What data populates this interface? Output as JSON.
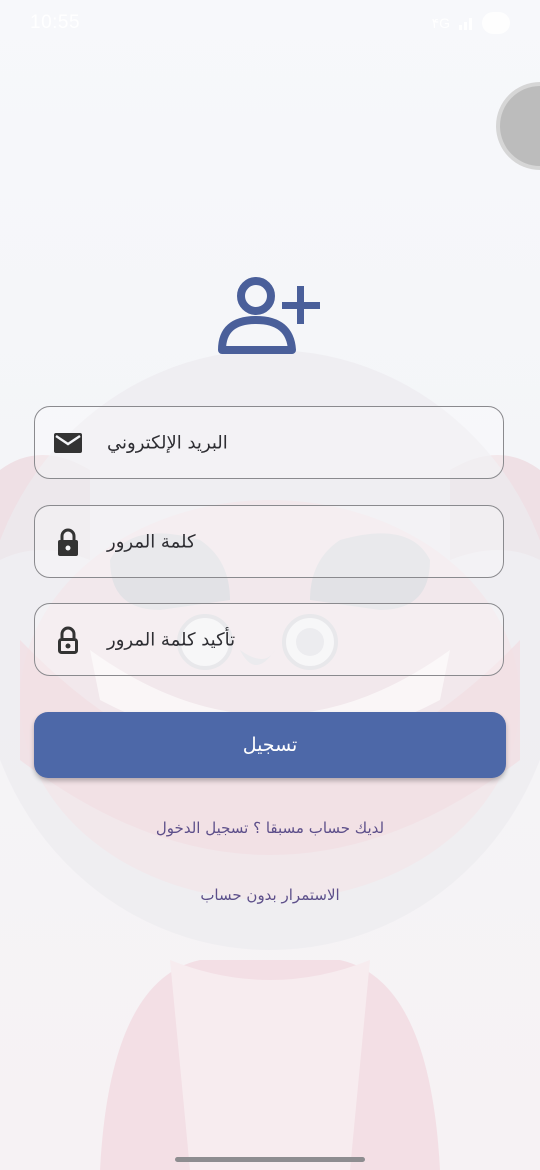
{
  "status_bar": {
    "time": "10:55",
    "signal_text": "۴G"
  },
  "header": {
    "icon": "person-add-icon"
  },
  "form": {
    "email": {
      "icon": "mail-icon",
      "placeholder": "البريد الإلكتروني"
    },
    "password": {
      "icon": "lock-icon",
      "placeholder": "كلمة المرور"
    },
    "confirm_password": {
      "icon": "lock-outline-icon",
      "placeholder": "تأكيد كلمة المرور"
    },
    "submit_label": "تسجيل"
  },
  "links": {
    "login": "لديك حساب مسبقا ؟ تسجيل الدخول",
    "guest": "الاستمرار بدون حساب"
  },
  "colors": {
    "accent": "#4d68a8",
    "icon": "#4a5f9a",
    "link": "#5d4f8a",
    "field_border": "#8a8a8e"
  }
}
